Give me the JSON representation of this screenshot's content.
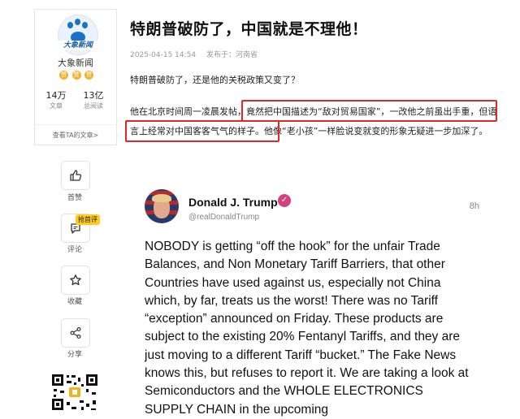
{
  "author": {
    "logo_text": "大象新闻",
    "name": "大象新闻",
    "badges": [
      "赞",
      "赞",
      "赞"
    ],
    "stats": [
      {
        "value": "14万",
        "label": "文章"
      },
      {
        "value": "13亿",
        "label": "总阅读"
      }
    ],
    "view_articles": "查看TA的文章>"
  },
  "actions": {
    "like": {
      "label": "首赞",
      "icon": "thumbs-up-icon"
    },
    "comment": {
      "label": "评论",
      "icon": "comment-icon",
      "badge": "抢首评"
    },
    "favorite": {
      "label": "收藏",
      "icon": "star-icon"
    },
    "share": {
      "label": "分享",
      "icon": "share-icon"
    }
  },
  "article": {
    "title": "特朗普破防了，中国就是不理他！",
    "datetime": "2025-04-15 14:54",
    "source": "发布于：河南省",
    "p1": "特朗普破防了，还是他的关税政策又变了？",
    "p2": "他在北京时间周一凌晨发帖，竟然把中国描述为“敌对贸易国家”，一改他之前虽出手重，但语言上经常对中国客客气气的样子。他像“老小孩”一样脸说变就变的形象无疑进一步加深了。"
  },
  "post": {
    "name": "Donald J. Trump",
    "handle": "@realDonaldTrump",
    "time": "8h",
    "body": "NOBODY is getting “off the hook” for the unfair Trade Balances, and Non Monetary Tariff Barriers, that other Countries have used against us, especially not China which, by far, treats us the worst! There was no Tariff “exception” announced on Friday. These products are subject to the existing 20% Fentanyl Tariffs, and they are just moving to a different Tariff “bucket.” The Fake News knows this, but refuses to report it. We are taking a look at Semiconductors and the WHOLE ELECTRONICS SUPPLY CHAIN in the upcoming"
  },
  "colors": {
    "highlight": "#e02828",
    "verified": "#d5417e",
    "badge": "#f3b12f",
    "hot_badge": "#ffcc1a"
  }
}
